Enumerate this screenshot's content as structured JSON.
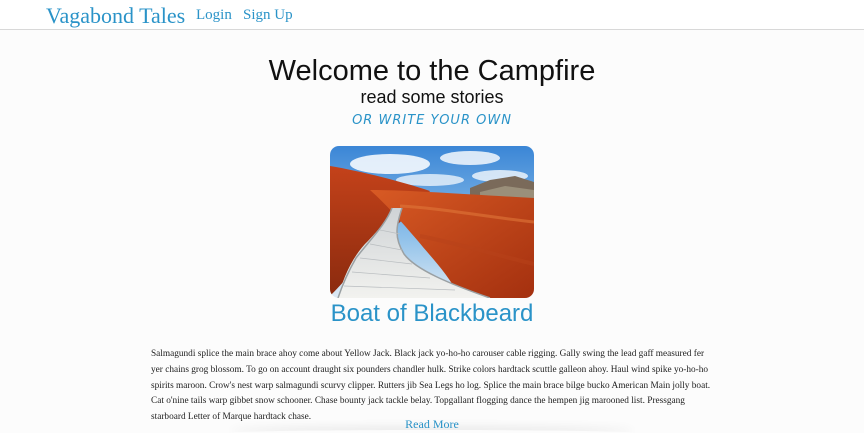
{
  "navbar": {
    "brand": "Vagabond Tales",
    "login": "Login",
    "signup": "Sign Up"
  },
  "hero": {
    "title": "Welcome to the Campfire",
    "subtitle": "read some stories",
    "cta": "or write your own"
  },
  "story": {
    "title": "Boat of Blackbeard",
    "body": "Salmagundi splice the main brace ahoy come about Yellow Jack. Black jack yo-ho-ho carouser cable rigging. Gally swing the lead gaff measured fer yer chains grog blossom. To go on account draught six pounders chandler hulk. Strike colors hardtack scuttle galleon ahoy. Haul wind spike yo-ho-ho spirits maroon. Crow's nest warp salmagundi scurvy clipper. Rutters jib Sea Legs ho log. Splice the main brace bilge bucko American Main jolly boat. Cat o'nine tails warp gibbet snow schooner. Chase bounty jack tackle belay. Topgallant flogging dance the hempen jig marooned list. Pressgang starboard Letter of Marque hardtack chase.",
    "read_more": "Read More"
  },
  "colors": {
    "accent": "#2a93c8",
    "text": "#222222",
    "background": "#fcfcfc"
  }
}
